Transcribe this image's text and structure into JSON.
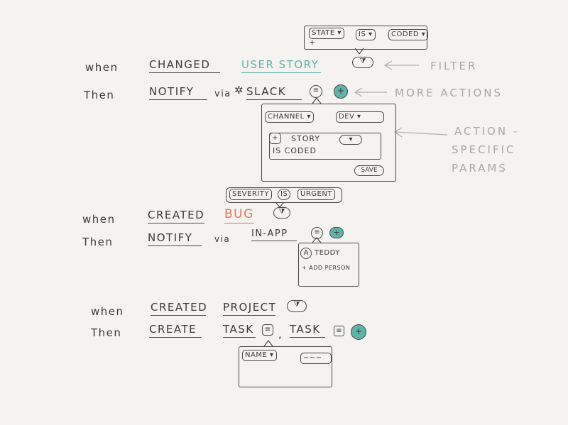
{
  "colors": {
    "accent_teal": "#5fb3ab",
    "accent_orange": "#e8735a",
    "note_gray": "#a8a8a8",
    "ink": "#3a3a3a",
    "paper": "#f4f3f0"
  },
  "rule1": {
    "when": "when",
    "event": "CHANGED",
    "object": "USER STORY",
    "then": "Then",
    "action": "NOTIFY",
    "via": "via",
    "channel_icon": "slack-icon",
    "channel": "SLACK",
    "filter_popover": {
      "field": "STATE",
      "operator": "IS",
      "value": "CODED",
      "add": "+"
    },
    "filter_icon": "filter-icon",
    "params_icon": "list-icon",
    "add_icon": "plus-icon",
    "params_popover": {
      "channel_label": "CHANNEL",
      "channel_value": "DEV",
      "message_insert": "+",
      "message_token": "STORY",
      "message_text": "IS CODED",
      "save": "SAVE"
    }
  },
  "rule2": {
    "when": "when",
    "event": "CREATED",
    "object": "BUG",
    "then": "Then",
    "action": "NOTIFY",
    "via": "via",
    "channel": "IN-APP",
    "filter_popover": {
      "field": "SEVERITY",
      "operator": "IS",
      "value": "URGENT"
    },
    "filter_icon": "filter-icon",
    "params_icon": "list-icon",
    "add_icon": "plus-icon",
    "recipients_popover": {
      "avatar": "A",
      "person": "TEDDY",
      "add_person": "+ ADD PERSON"
    }
  },
  "rule3": {
    "when": "when",
    "event": "CREATED",
    "object": "PROJECT",
    "then": "Then",
    "action": "CREATE",
    "target1": "TASK",
    "separator": ",",
    "target2": "TASK",
    "filter_icon": "filter-icon",
    "params_icon": "list-icon",
    "add_icon": "plus-icon",
    "task_popover": {
      "field": "NAME",
      "value": "~~~"
    }
  },
  "annotations": {
    "filter": "FILTER",
    "more_actions": "MORE ACTIONS",
    "action_specific_params": [
      "ACTION -",
      "SPECIFIC",
      "PARAMS"
    ]
  },
  "glyphs": {
    "filter": "⧩",
    "list": "≡",
    "plus": "+",
    "slack": "✲",
    "dropdown": "▾"
  }
}
